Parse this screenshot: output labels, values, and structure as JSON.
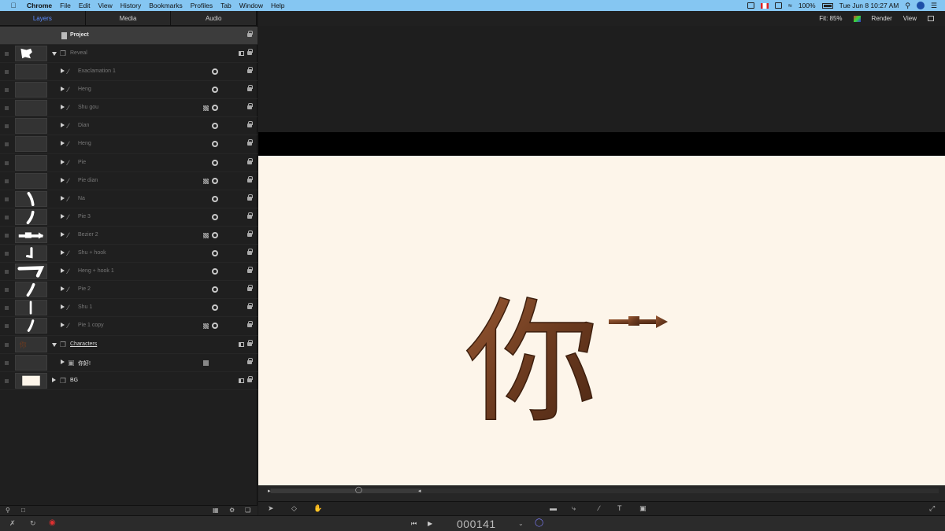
{
  "menubar": {
    "app": "Chrome",
    "items": [
      "File",
      "Edit",
      "View",
      "History",
      "Bookmarks",
      "Profiles",
      "Tab",
      "Window",
      "Help"
    ],
    "battery": "100%",
    "datetime": "Tue Jun 8  10:27 AM"
  },
  "panel_tabs": [
    "Layers",
    "Media",
    "Audio"
  ],
  "canvas_bar": {
    "fit": "Fit: 85%",
    "render": "Render",
    "view": "View"
  },
  "layers": [
    {
      "name": "Project"
    },
    {
      "name": "Reveal"
    },
    {
      "name": "Exaclamation 1"
    },
    {
      "name": "Heng"
    },
    {
      "name": "Shu gou"
    },
    {
      "name": "Dian"
    },
    {
      "name": "Heng"
    },
    {
      "name": "Pie"
    },
    {
      "name": "Pie dian"
    },
    {
      "name": "Na"
    },
    {
      "name": "Pie 3"
    },
    {
      "name": "Bezier 2"
    },
    {
      "name": "Shu + hook"
    },
    {
      "name": "Heng + hook 1"
    },
    {
      "name": "Pie 2"
    },
    {
      "name": "Shu 1"
    },
    {
      "name": "Pie 1 copy"
    },
    {
      "name": "Characters"
    },
    {
      "name": "你好!"
    },
    {
      "name": "BG"
    }
  ],
  "canvas_text": "你",
  "timecode": "000141",
  "colors": {
    "bg_cream": "#fdf5ea",
    "glyph_brown": "#6b3a1f",
    "accent_blue": "#5b8cff"
  }
}
